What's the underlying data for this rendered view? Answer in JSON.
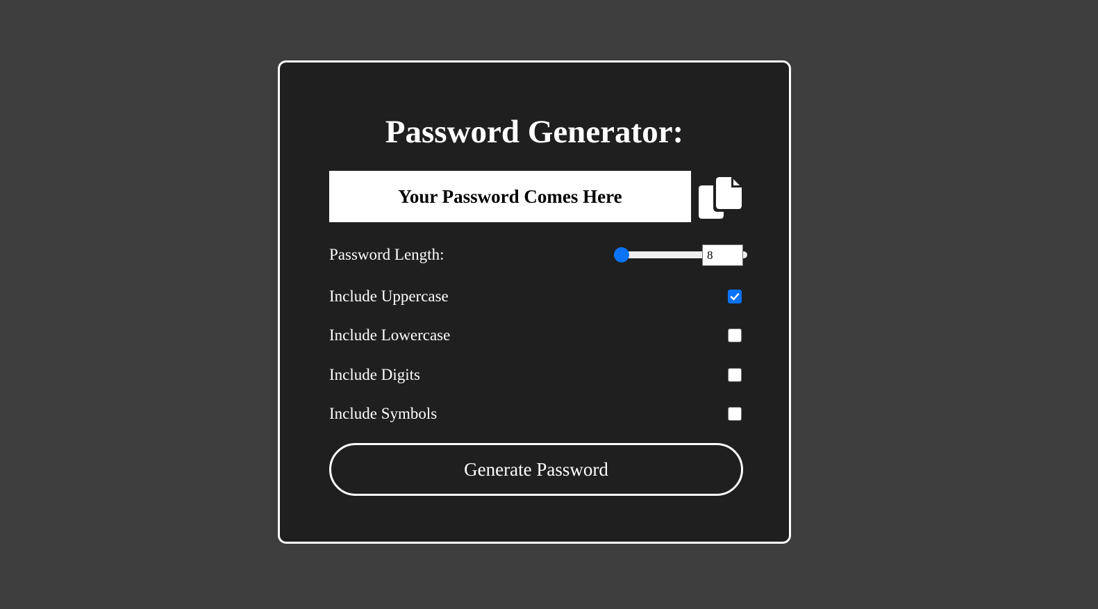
{
  "title": "Password Generator:",
  "password_display": "Your Password Comes Here",
  "copy_icon": "copy-icon",
  "length": {
    "label": "Password Length:",
    "value": "8",
    "slider_fraction": 0
  },
  "options": [
    {
      "label": "Include Uppercase",
      "checked": true
    },
    {
      "label": "Include Lowercase",
      "checked": false
    },
    {
      "label": "Include Digits",
      "checked": false
    },
    {
      "label": "Include Symbols",
      "checked": false
    }
  ],
  "generate_button": "Generate Password",
  "colors": {
    "page_background": "#3e3e3e",
    "card_background": "#1f1f1f",
    "accent": "#0b73f5",
    "border": "#ffffff"
  }
}
